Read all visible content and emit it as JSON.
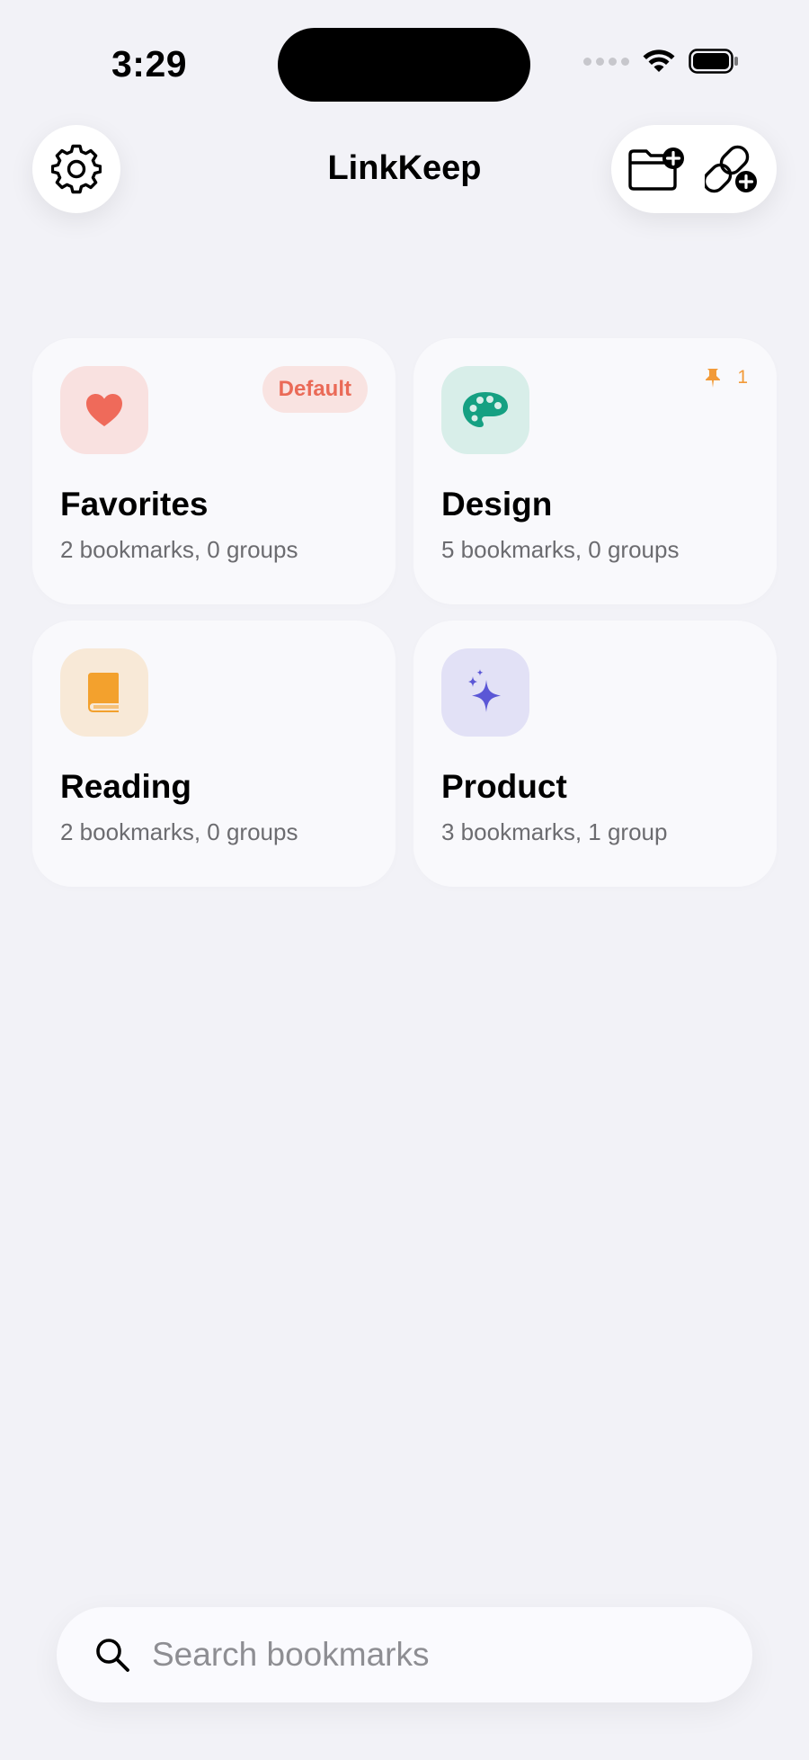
{
  "status_bar": {
    "time": "3:29"
  },
  "header": {
    "title": "LinkKeep"
  },
  "collections": [
    {
      "title": "Favorites",
      "subtitle": "2 bookmarks, 0 groups",
      "icon": "heart-icon",
      "icon_color": "#ef6a5a",
      "tile_color": "#f9e1e0",
      "badge": "Default"
    },
    {
      "title": "Design",
      "subtitle": "5 bookmarks, 0 groups",
      "icon": "palette-icon",
      "icon_color": "#15a082",
      "tile_color": "#d8eee9",
      "pinned_count": "1"
    },
    {
      "title": "Reading",
      "subtitle": "2 bookmarks, 0 groups",
      "icon": "book-icon",
      "icon_color": "#f3a12d",
      "tile_color": "#f8e9d7"
    },
    {
      "title": "Product",
      "subtitle": "3 bookmarks, 1 group",
      "icon": "sparkles-icon",
      "icon_color": "#5b57d6",
      "tile_color": "#e2e1f6"
    }
  ],
  "search": {
    "placeholder": "Search bookmarks"
  },
  "colors": {
    "background": "#f2f2f7",
    "card": "#f9f9fc",
    "pin": "#f29a38"
  }
}
